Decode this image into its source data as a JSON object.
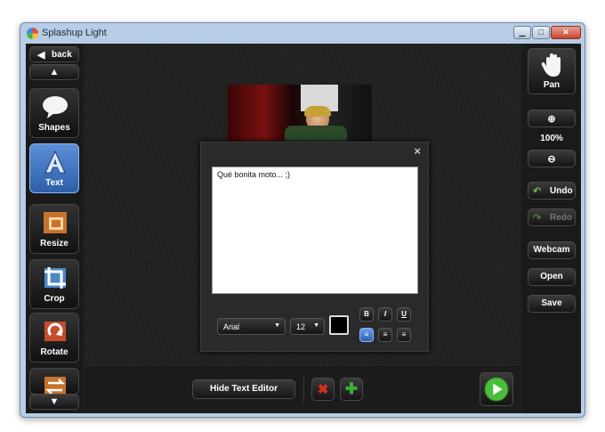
{
  "window": {
    "title": "Splashup Light",
    "controls": {
      "minimize": "▁",
      "maximize": "□",
      "close": "✕"
    }
  },
  "left_toolbar": {
    "back_label": "back",
    "scroll_up": "▲",
    "scroll_down": "▼",
    "tools": [
      {
        "label": "Shapes",
        "icon": "speech-bubble-icon",
        "active": false
      },
      {
        "label": "Text",
        "icon": "text-a-icon",
        "active": true
      },
      {
        "label": "Resize",
        "icon": "resize-icon",
        "active": false
      },
      {
        "label": "Crop",
        "icon": "crop-icon",
        "active": false
      },
      {
        "label": "Rotate",
        "icon": "rotate-icon",
        "active": false
      },
      {
        "label": "",
        "icon": "flip-icon",
        "active": false
      }
    ]
  },
  "right_toolbar": {
    "pan_label": "Pan",
    "zoom_level": "100%",
    "undo_label": "Undo",
    "redo_label": "Redo",
    "webcam_label": "Webcam",
    "open_label": "Open",
    "save_label": "Save"
  },
  "text_editor": {
    "close_glyph": "×",
    "content": "Qué bonita moto... ;)",
    "font": "Arial",
    "size": "12",
    "text_color": "#000000",
    "bold_label": "B",
    "italic_label": "I",
    "underline_label": "U",
    "align_left_glyph": "≡",
    "align_center_glyph": "≡",
    "align_right_glyph": "≡",
    "alignment": "left"
  },
  "bottom_bar": {
    "hide_text_editor_label": "Hide Text Editor",
    "cancel_glyph": "✖",
    "add_glyph": "✚"
  },
  "colors": {
    "accent_blue": "#3b74c4",
    "cancel_red": "#d3301f",
    "add_green": "#3fae35",
    "play_green": "#4bbd3c"
  }
}
